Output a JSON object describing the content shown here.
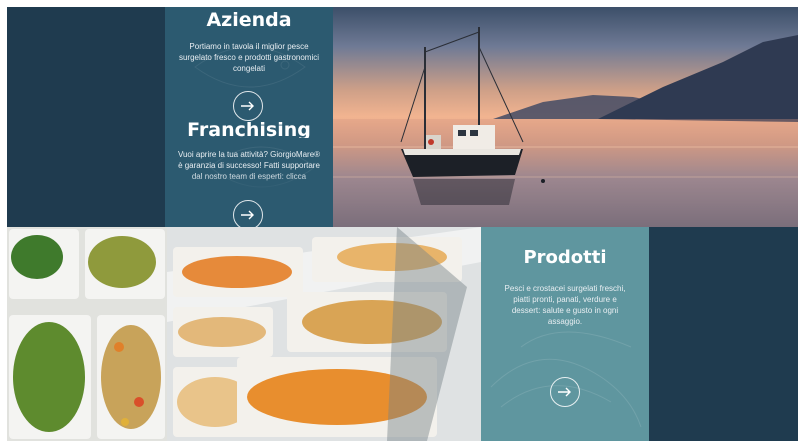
{
  "azienda": {
    "title": "Azienda",
    "description": "Portiamo in tavola il miglior pesce surgelato fresco e prodotti gastronomici congelati"
  },
  "franchising": {
    "title": "Franchising",
    "description": "Vuoi aprire la tua attività? GiorgioMare® è garanzia di successo! Fatti supportare dal nostro team di esperti: clicca"
  },
  "prodotti": {
    "title": "Prodotti",
    "description": "Pesci e crostacei surgelati freschi, piatti pronti, panati, verdure e dessert: salute e gusto in ogni assaggio."
  },
  "colors": {
    "dark_navy": "#1f3b4f",
    "panel_blue": "#2c5a70",
    "panel_teal": "#5f969f"
  },
  "icons": [
    "arrow-right-icon"
  ]
}
